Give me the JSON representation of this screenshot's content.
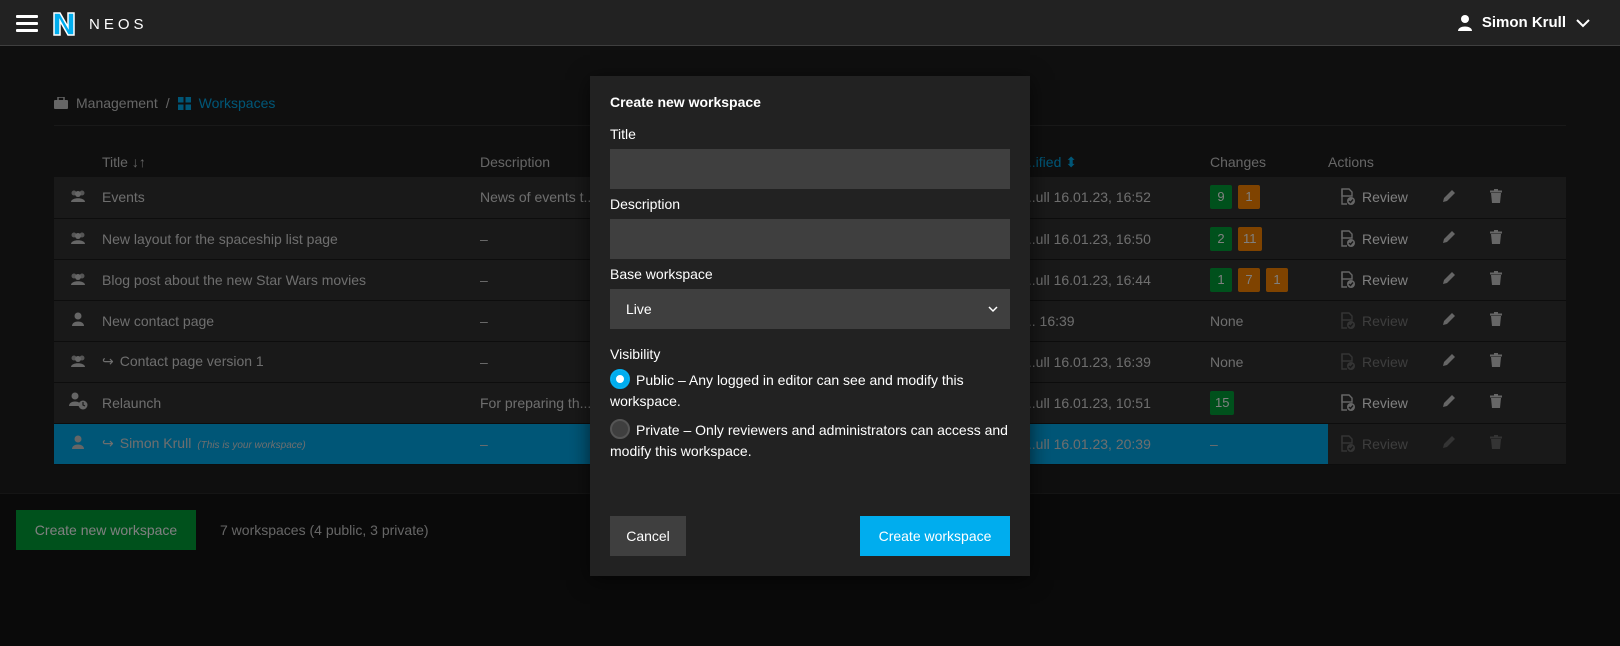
{
  "app": {
    "brand": "NEOS",
    "user_name": "Simon Krull",
    "menu_icon": "hamburger-icon",
    "accent": "#00adee",
    "success": "#00a338",
    "warning": "#ff8700"
  },
  "breadcrumb": {
    "root": "Management",
    "separator": "/",
    "current": "Workspaces"
  },
  "table": {
    "headers": {
      "title": "Title",
      "description": "Description",
      "modified": "...ified",
      "changes": "Changes",
      "actions": "Actions"
    },
    "rows": [
      {
        "type_icon": "group-icon",
        "title": "Events",
        "description": "News of events t...",
        "modified": "...ull 16.01.23, 16:52",
        "changes": [
          {
            "n": "9",
            "c": "green"
          },
          {
            "n": "1",
            "c": "orange"
          }
        ],
        "review": "Review"
      },
      {
        "type_icon": "group-icon",
        "title": "New layout for the spaceship list page",
        "description": "–",
        "modified": "...ull 16.01.23, 16:50",
        "changes": [
          {
            "n": "2",
            "c": "green"
          },
          {
            "n": "11",
            "c": "orange"
          }
        ],
        "review": "Review"
      },
      {
        "type_icon": "group-icon",
        "title": "Blog post about the new Star Wars movies",
        "description": "–",
        "modified": "...ull 16.01.23, 16:44",
        "changes": [
          {
            "n": "1",
            "c": "green"
          },
          {
            "n": "7",
            "c": "orange"
          },
          {
            "n": "1",
            "c": "orange"
          }
        ],
        "review": "Review"
      },
      {
        "type_icon": "user-icon",
        "title": "New contact page",
        "description": "–",
        "modified": "... 16:39",
        "changes_text": "None",
        "review": "Review"
      },
      {
        "type_icon": "group-icon",
        "title": "Contact page version 1",
        "description": "–",
        "modified": "...ull 16.01.23, 16:39",
        "changes_text": "None",
        "review": "Review"
      },
      {
        "type_icon": "private-group-icon",
        "title": "Relaunch",
        "description": "For preparing th...",
        "modified": "...ull 16.01.23, 10:51",
        "changes": [
          {
            "n": "15",
            "c": "green"
          }
        ],
        "review": "Review"
      },
      {
        "type_icon": "user-icon",
        "title": "Simon Krull",
        "note": "(This is your workspace)",
        "description": "–",
        "modified": "...ull 16.01.23, 20:39",
        "changes_text": "–",
        "review": "Review"
      }
    ]
  },
  "footer": {
    "create_button": "Create new workspace",
    "count_text": "7 workspaces (4 public, 3 private)"
  },
  "modal": {
    "title": "Create new workspace",
    "title_label": "Title",
    "title_value": "",
    "description_label": "Description",
    "description_value": "",
    "base_label": "Base workspace",
    "base_value": "Live",
    "visibility_label": "Visibility",
    "public_option": "Public – Any logged in editor can see and modify this workspace.",
    "private_option": "Private – Only reviewers and administrators can access and modify this workspace.",
    "selected_visibility": "public",
    "cancel_button": "Cancel",
    "submit_button": "Create workspace"
  }
}
